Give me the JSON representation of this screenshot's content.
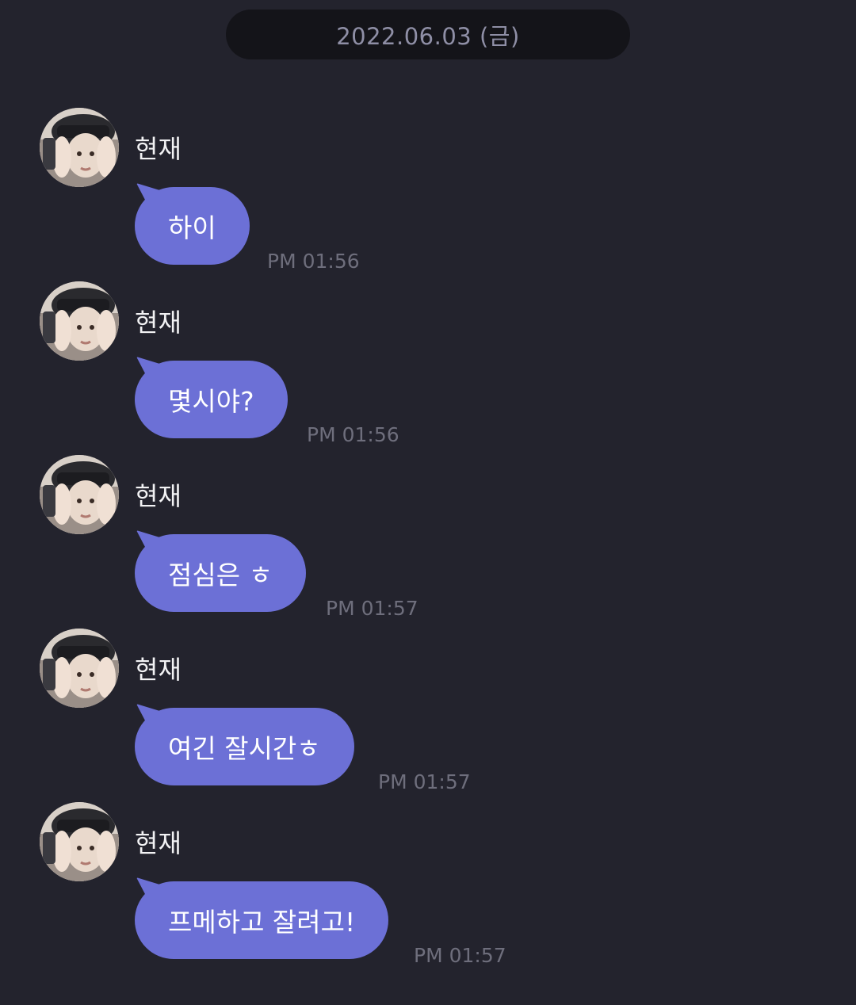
{
  "date_header": "2022.06.03 (금)",
  "messages": [
    {
      "sender": "현재",
      "text": "하이",
      "time": "PM 01:56"
    },
    {
      "sender": "현재",
      "text": "몇시야?",
      "time": "PM 01:56"
    },
    {
      "sender": "현재",
      "text": "점심은 ㅎ",
      "time": "PM 01:57"
    },
    {
      "sender": "현재",
      "text": "여긴 잘시간ㅎ",
      "time": "PM 01:57"
    },
    {
      "sender": "현재",
      "text": "프메하고 잘려고!",
      "time": "PM 01:57"
    }
  ],
  "colors": {
    "background": "#23232d",
    "date_pill": "#141419",
    "bubble": "#6c70d6",
    "timestamp": "#6e6e7c"
  },
  "icons": {
    "avatar": "profile-photo"
  }
}
